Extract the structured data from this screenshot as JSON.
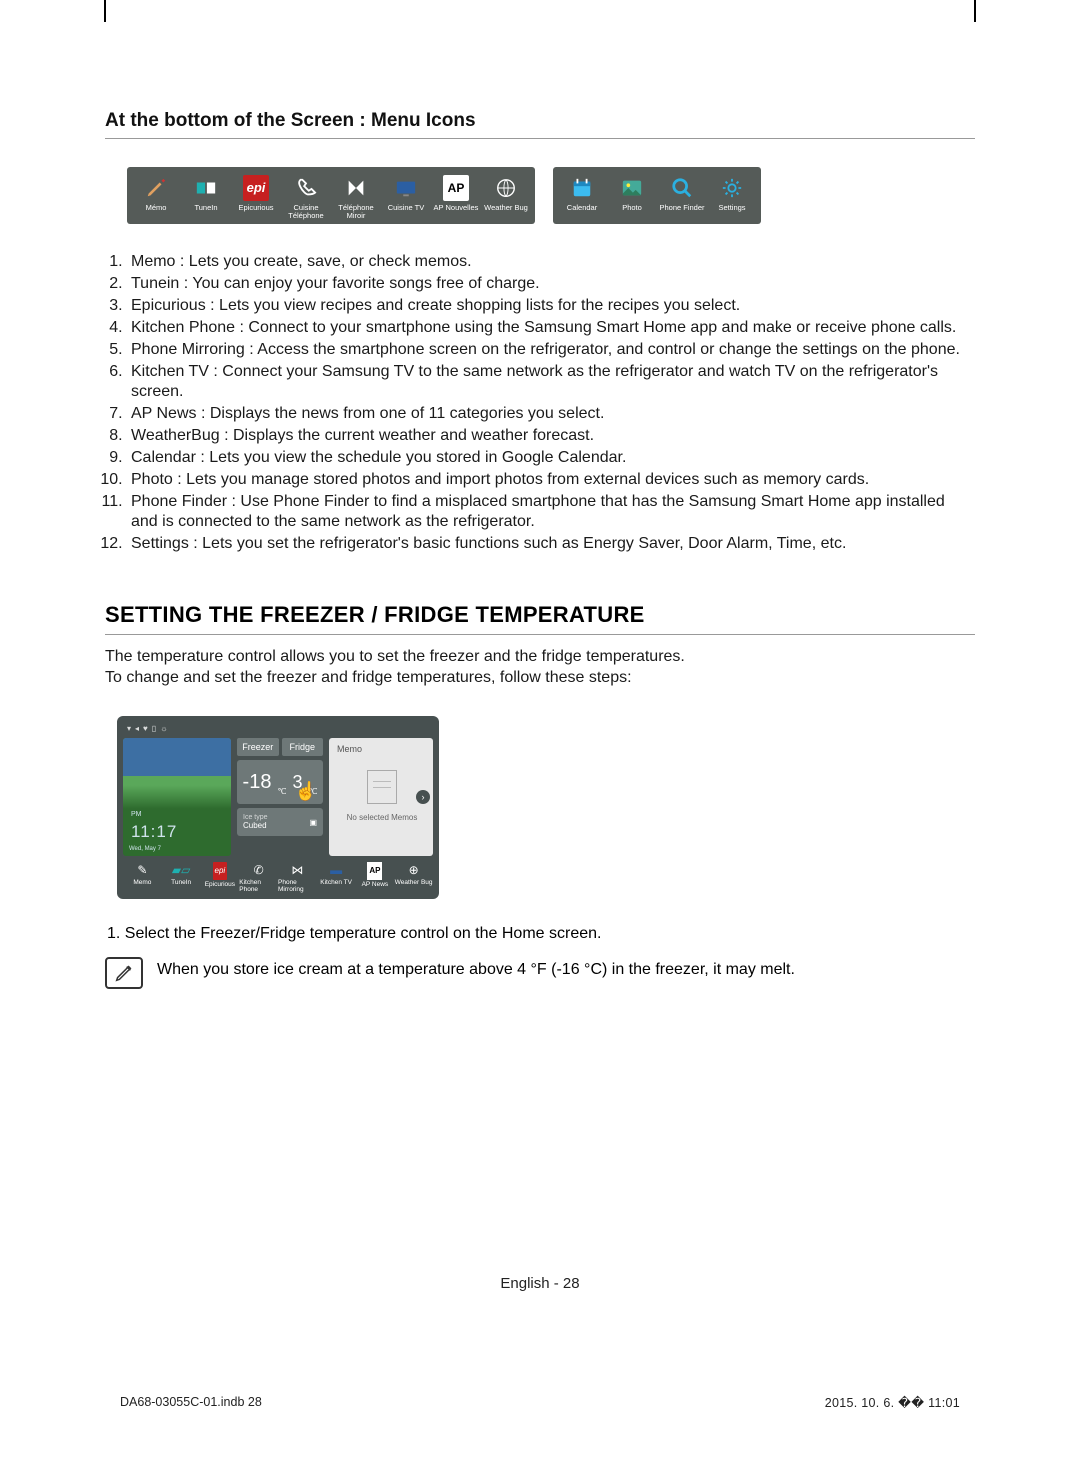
{
  "section1": {
    "heading": "At the bottom of the Screen : Menu Icons"
  },
  "bar1": [
    "Mémo",
    "TuneIn",
    "Epicurious",
    "Cuisine Téléphone",
    "Téléphone Miroir",
    "Cuisine TV",
    "AP Nouvelles",
    "Weather Bug"
  ],
  "bar2": [
    "Calendar",
    "Photo",
    "Phone Finder",
    "Settings"
  ],
  "descriptions": [
    "Memo : Lets you create, save, or check memos.",
    "Tunein : You can enjoy your favorite songs free of charge.",
    "Epicurious : Lets you view recipes and create shopping lists for the recipes you select.",
    "Kitchen Phone : Connect to your smartphone using the Samsung Smart Home app and make or receive phone calls.",
    "Phone Mirroring : Access the smartphone screen on the refrigerator, and control or change the settings on the phone.",
    "Kitchen TV : Connect your Samsung TV to the same network as the refrigerator and watch TV on the refrigerator's screen.",
    "AP News : Displays the news from one of 11 categories you select.",
    "WeatherBug : Displays the current weather and weather forecast.",
    "Calendar : Lets you view the schedule you stored in Google Calendar.",
    "Photo : Lets you manage stored photos and import photos from external devices such as memory cards.",
    "Phone Finder : Use Phone Finder to find a misplaced smartphone that has the Samsung Smart Home app installed and is connected to the same network as the refrigerator.",
    "Settings : Lets you set the refrigerator's basic functions such as Energy Saver, Door Alarm, Time, etc."
  ],
  "section2": {
    "heading": "SETTING THE FREEZER / FRIDGE TEMPERATURE",
    "intro1": "The temperature control allows you to set the freezer and the fridge temperatures.",
    "intro2": "To change and set the freezer and fridge temperatures, follow these steps:"
  },
  "screen": {
    "day": "PM",
    "time": "11:17",
    "date": "Wed, May 7",
    "freezer_label": "Freezer",
    "fridge_label": "Fridge",
    "freezer_temp": "-18",
    "fridge_temp": "3",
    "unit": "℃",
    "ice_label": "Ice type",
    "ice_value": "Cubed",
    "memo_title": "Memo",
    "memo_empty": "No selected Memos",
    "dock": [
      "Memo",
      "TuneIn",
      "Epicurious",
      "Kitchen Phone",
      "Phone Mirroring",
      "Kitchen TV",
      "AP News",
      "Weather Bug"
    ]
  },
  "steps": [
    "1.  Select the Freezer/Fridge temperature control on the Home screen."
  ],
  "note": "When you store ice cream at a temperature above 4 °F (-16 °C) in the freezer, it may melt.",
  "footer": {
    "center": "English - 28",
    "left": "DA68-03055C-01.indb   28",
    "right": "2015. 10. 6.   �� 11:01"
  }
}
